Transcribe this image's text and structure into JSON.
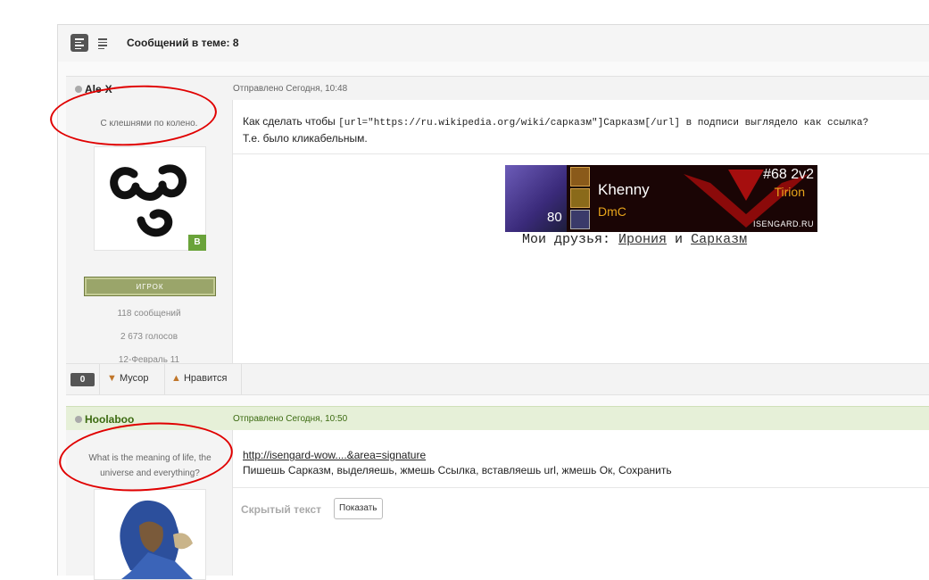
{
  "toolbar": {
    "view_threaded_icon": "threaded-view-icon",
    "view_linear_icon": "linear-view-icon",
    "title": "Сообщений в теме: 8"
  },
  "posts": [
    {
      "author": "Ale-X",
      "sent": "Отправлено Сегодня, 10:48",
      "motto": "С клешнями по колено.",
      "group_badge": "игрок",
      "rank_letter": "B",
      "stats": {
        "messages": "118 сообщений",
        "votes": "2 673 голосов",
        "joined": "12-Февраль 11"
      },
      "message_pre": "Как сделать чтобы ",
      "message_code": "[url=\"https://ru.wikipedia.org/wiki/сарказм\"]Сарказм[/url] в подписи выглядело как ссылка?",
      "message_line2": "Т.е. было кликабельным.",
      "signature": {
        "level": "80",
        "name": "Khenny",
        "guild": "DmC",
        "rank": "#68 2v2",
        "realm": "Tirion",
        "site": "ISENGARD.RU",
        "friends_pre": "Мои друзья: ",
        "friend1": "Ирония",
        "and": " и ",
        "friend2": "Сарказм"
      },
      "rating": "0",
      "trash_label": "Мусор",
      "like_label": "Нравится"
    },
    {
      "author": "Hoolaboo",
      "sent": "Отправлено Сегодня, 10:50",
      "motto": "What is the meaning of life, the universe and everything?",
      "link": "http://isengard-wow....&area=signature",
      "message": "Пишешь Сарказм, выделяешь, жмешь Ссылка, вставляешь url, жмешь Ок, Сохранить",
      "hidden_label": "Скрытый текст",
      "show_button": "Показать"
    }
  ],
  "colors": {
    "accent_annotation": "#e00000",
    "post2_header": "#e6f0d8",
    "author2_color": "#3b6a10"
  }
}
